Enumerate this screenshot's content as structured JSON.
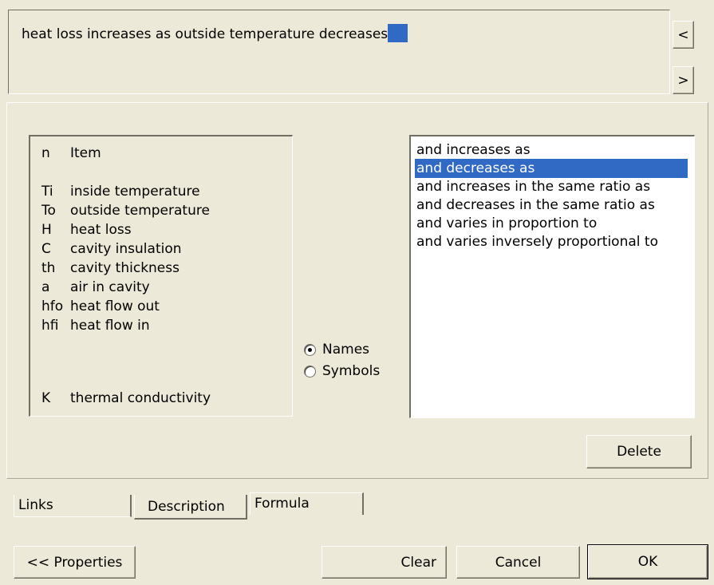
{
  "description_text": "heat loss increases as outside temperature decreases",
  "scroll_buttons": {
    "prev": "<",
    "next": ">"
  },
  "items": {
    "header": {
      "symbol": "n",
      "name": "Item"
    },
    "rows": [
      {
        "symbol": "Ti",
        "name": "inside temperature"
      },
      {
        "symbol": "To",
        "name": "outside temperature"
      },
      {
        "symbol": "H",
        "name": "heat loss"
      },
      {
        "symbol": "C",
        "name": "cavity insulation"
      },
      {
        "symbol": "th",
        "name": "cavity thickness"
      },
      {
        "symbol": "a",
        "name": "air in cavity"
      },
      {
        "symbol": "hfo",
        "name": "heat flow out"
      },
      {
        "symbol": "hfi",
        "name": "heat flow in"
      }
    ],
    "extra": {
      "symbol": "K",
      "name": "thermal conductivity"
    }
  },
  "display_mode": {
    "options": [
      "Names",
      "Symbols"
    ],
    "selected": "Names"
  },
  "relations": {
    "options": [
      "and increases as",
      "and decreases as",
      "and increases in the same ratio as",
      "and decreases in the same ratio as",
      "and varies in proportion to",
      "and varies inversely proportional to"
    ],
    "selected_index": 1
  },
  "delete_label": "Delete",
  "tabs": [
    "Links",
    "Description",
    "Formula"
  ],
  "active_tab": "Description",
  "footer": {
    "properties_label": "<< Properties",
    "clear_label": "Clear",
    "cancel_label": "Cancel",
    "ok_label": "OK"
  },
  "colors": {
    "selection": "#316ac5",
    "face": "#ece9d8"
  }
}
